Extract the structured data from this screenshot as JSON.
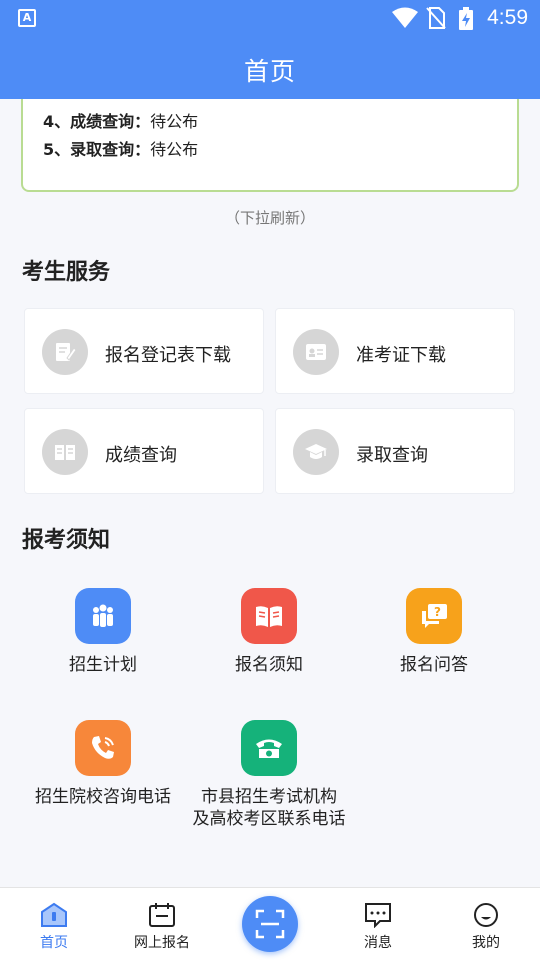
{
  "status_bar": {
    "time": "4:59",
    "app_badge": "A"
  },
  "header": {
    "title": "首页"
  },
  "notice_card": {
    "lines": [
      {
        "label": "4、成绩查询：",
        "value": "待公布"
      },
      {
        "label": "5、录取查询：",
        "value": "待公布"
      }
    ]
  },
  "pull_hint": "（下拉刷新）",
  "services": {
    "title": "考生服务",
    "items": [
      {
        "label": "报名登记表下载",
        "icon": "form-edit-icon"
      },
      {
        "label": "准考证下载",
        "icon": "id-card-icon"
      },
      {
        "label": "成绩查询",
        "icon": "open-book-icon"
      },
      {
        "label": "录取查询",
        "icon": "graduation-cap-icon"
      }
    ]
  },
  "notices": {
    "title": "报考须知",
    "items": [
      {
        "label": "招生计划",
        "color": "#4e8cf6",
        "icon": "people-icon"
      },
      {
        "label": "报名须知",
        "color": "#f0574a",
        "icon": "book-icon"
      },
      {
        "label": "报名问答",
        "color": "#f7a21b",
        "icon": "question-chat-icon"
      },
      {
        "label": "招生院校咨询电话",
        "color": "#f7873a",
        "icon": "phone-icon"
      },
      {
        "label": "市县招生考试机构\n及高校考区联系电话",
        "line1": "市县招生考试机构",
        "line2": "及高校考区联系电话",
        "color": "#15b27a",
        "icon": "telephone-icon"
      }
    ]
  },
  "bottom_nav": {
    "items": [
      {
        "label": "首页",
        "icon": "home-icon",
        "active": true
      },
      {
        "label": "网上报名",
        "icon": "calendar-icon",
        "active": false
      },
      {
        "label": "",
        "icon": "scan-icon",
        "active": false
      },
      {
        "label": "消息",
        "icon": "message-icon",
        "active": false
      },
      {
        "label": "我的",
        "icon": "user-face-icon",
        "active": false
      }
    ]
  },
  "colors": {
    "primary": "#4e8cf6",
    "card_border": "#b9dc92",
    "active_nav": "#3d7bf0"
  }
}
